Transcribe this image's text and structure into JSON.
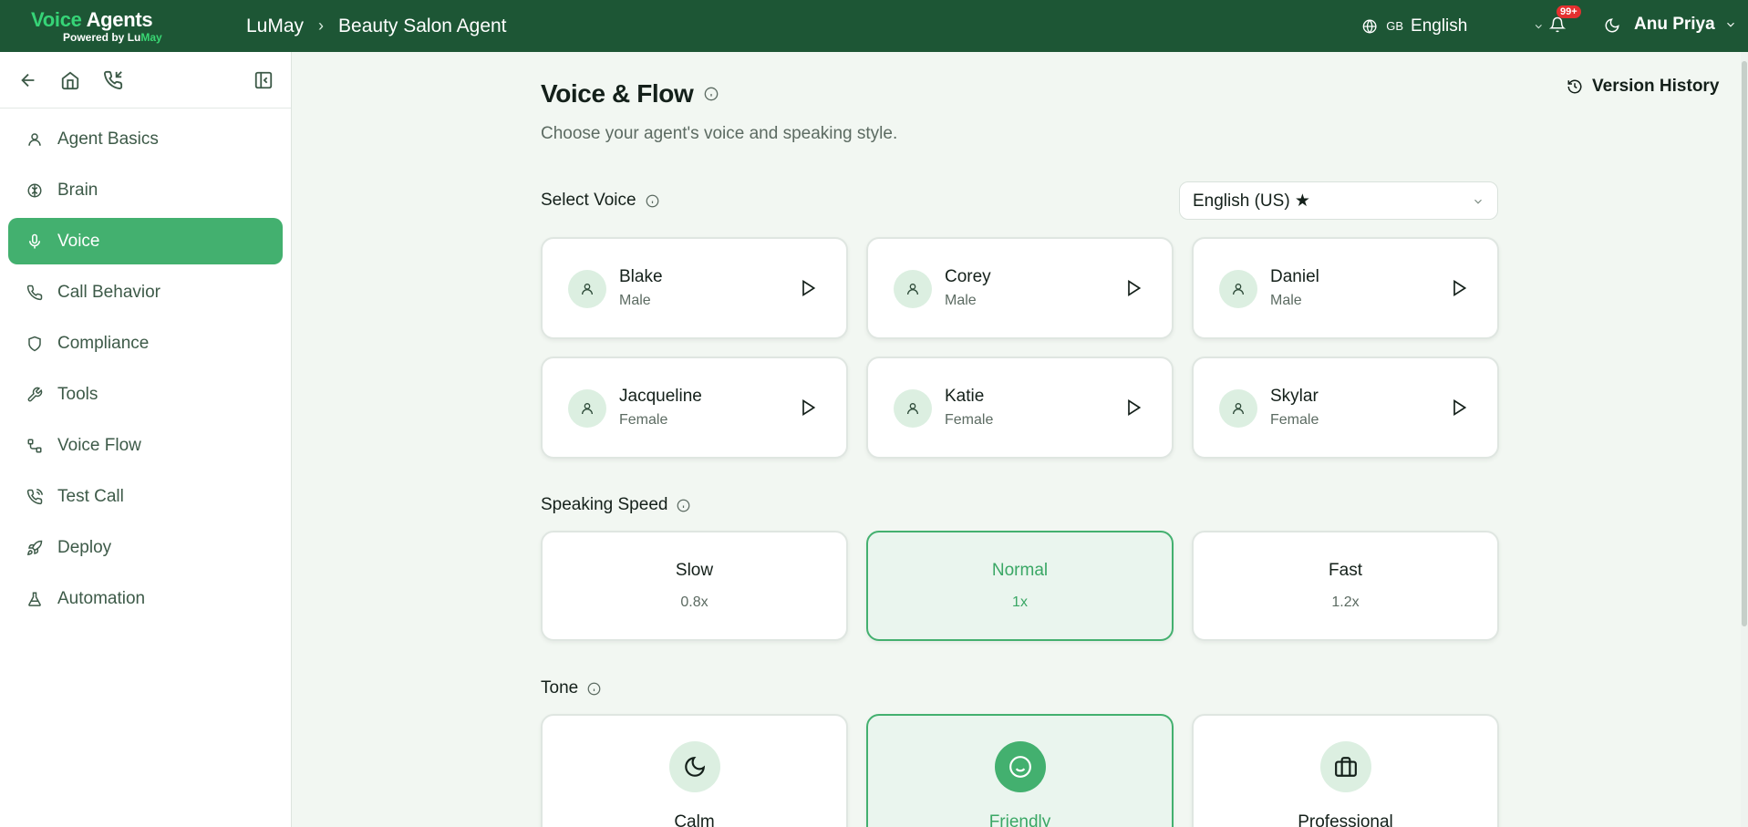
{
  "brand": {
    "title_a": "Voice",
    "title_b": " Agents",
    "sub_a": "Powered by ",
    "sub_b": "Lu",
    "sub_c": "May"
  },
  "breadcrumb": {
    "org": "LuMay",
    "separator": "›",
    "agent": "Beauty Salon Agent"
  },
  "header": {
    "language_code": "GB",
    "language": "English",
    "notification_badge": "99+",
    "user_name": "Anu Priya"
  },
  "sidebar": {
    "items": [
      {
        "label": "Agent Basics",
        "icon": "user-icon",
        "active": false
      },
      {
        "label": "Brain",
        "icon": "brain-icon",
        "active": false
      },
      {
        "label": "Voice",
        "icon": "mic-icon",
        "active": true
      },
      {
        "label": "Call Behavior",
        "icon": "phone-icon",
        "active": false
      },
      {
        "label": "Compliance",
        "icon": "shield-icon",
        "active": false
      },
      {
        "label": "Tools",
        "icon": "wrench-icon",
        "active": false
      },
      {
        "label": "Voice Flow",
        "icon": "flow-icon",
        "active": false
      },
      {
        "label": "Test Call",
        "icon": "phone-call-icon",
        "active": false
      },
      {
        "label": "Deploy",
        "icon": "rocket-icon",
        "active": false
      },
      {
        "label": "Automation",
        "icon": "flask-icon",
        "active": false
      }
    ]
  },
  "page": {
    "title": "Voice & Flow",
    "subtitle": "Choose your agent's voice and speaking style.",
    "version_history": "Version History"
  },
  "voice": {
    "label": "Select Voice",
    "language_select": "English (US) ★",
    "voices": [
      {
        "name": "Blake",
        "gender": "Male"
      },
      {
        "name": "Corey",
        "gender": "Male"
      },
      {
        "name": "Daniel",
        "gender": "Male"
      },
      {
        "name": "Jacqueline",
        "gender": "Female"
      },
      {
        "name": "Katie",
        "gender": "Female"
      },
      {
        "name": "Skylar",
        "gender": "Female"
      }
    ]
  },
  "speed": {
    "label": "Speaking Speed",
    "options": [
      {
        "label": "Slow",
        "value": "0.8x",
        "selected": false
      },
      {
        "label": "Normal",
        "value": "1x",
        "selected": true
      },
      {
        "label": "Fast",
        "value": "1.2x",
        "selected": false
      }
    ]
  },
  "tone": {
    "label": "Tone",
    "options": [
      {
        "label": "Calm",
        "icon": "moon-icon",
        "selected": false
      },
      {
        "label": "Friendly",
        "icon": "smile-icon",
        "selected": true
      },
      {
        "label": "Professional",
        "icon": "briefcase-icon",
        "selected": false
      }
    ]
  },
  "colors": {
    "header_bg": "#1d5635",
    "accent": "#43b06f",
    "page_bg": "#f2f7f2"
  }
}
